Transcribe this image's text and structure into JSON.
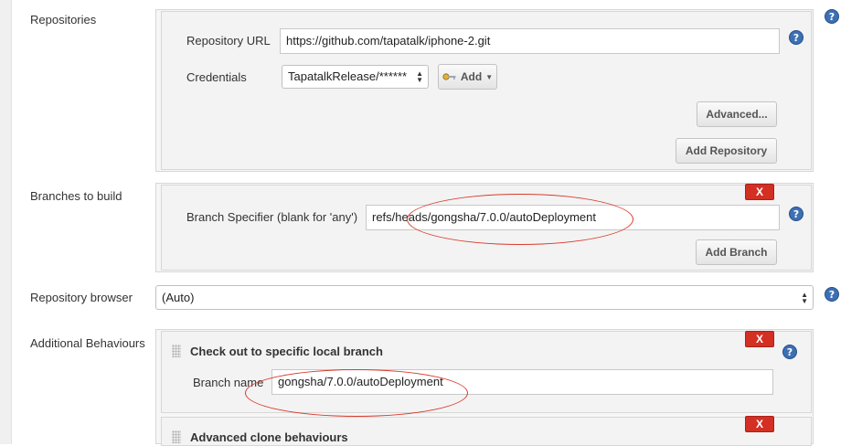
{
  "repositories": {
    "label": "Repositories",
    "repository_url_label": "Repository URL",
    "repository_url_value": "https://github.com/tapatalk/iphone-2.git",
    "credentials_label": "Credentials",
    "credentials_value": "TapatalkRelease/******",
    "add_button_label": "Add",
    "advanced_button_label": "Advanced...",
    "add_repository_button_label": "Add Repository"
  },
  "branches": {
    "label": "Branches to build",
    "branch_specifier_label": "Branch Specifier (blank for 'any')",
    "branch_specifier_value": "refs/heads/gongsha/7.0.0/autoDeployment",
    "delete_label": "X",
    "add_branch_button_label": "Add Branch"
  },
  "repository_browser": {
    "label": "Repository browser",
    "value": "(Auto)"
  },
  "additional_behaviours": {
    "label": "Additional Behaviours",
    "items": [
      {
        "title": "Check out to specific local branch",
        "branch_name_label": "Branch name",
        "branch_name_value": "gongsha/7.0.0/autoDeployment",
        "delete_label": "X"
      },
      {
        "title": "Advanced clone behaviours",
        "delete_label": "X"
      }
    ]
  },
  "help_icon_glyph": "?",
  "icons": [
    "help-icon",
    "key-icon",
    "select-arrows-icon",
    "drag-handle-icon"
  ],
  "colors": {
    "delete_button": "#d32f23",
    "help_icon": "#3d6fb3",
    "annotation_ellipse": "#d93a2a"
  }
}
